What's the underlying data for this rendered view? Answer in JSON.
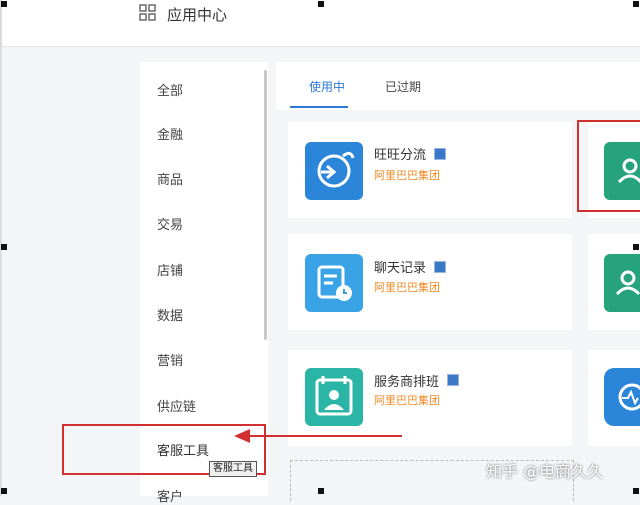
{
  "header": {
    "title": "应用中心",
    "icon": "grid-icon"
  },
  "sidebar": {
    "items": [
      {
        "label": "全部"
      },
      {
        "label": "金融"
      },
      {
        "label": "商品"
      },
      {
        "label": "交易"
      },
      {
        "label": "店铺"
      },
      {
        "label": "数据"
      },
      {
        "label": "营销"
      },
      {
        "label": "供应链"
      },
      {
        "label": "客服工具"
      },
      {
        "label": "客户"
      }
    ],
    "tooltip": "客服工具"
  },
  "tabs": [
    {
      "label": "使用中"
    },
    {
      "label": "已过期"
    }
  ],
  "apps": [
    {
      "name": "旺旺分流",
      "org": "阿里巴巴集团",
      "icon": "wangwang-icon",
      "color": "#2b86d9"
    },
    {
      "name": "聊天记录",
      "org": "阿里巴巴集团",
      "icon": "chat-record-icon",
      "color": "#3aa3e6"
    },
    {
      "name": "服务商排班",
      "org": "阿里巴巴集团",
      "icon": "schedule-icon",
      "color": "#2bb5a6"
    }
  ],
  "colors": {
    "accent": "#2d7ad6",
    "org": "#f08a24",
    "annotation": "#d23030"
  },
  "watermark": "知乎 @电商久久"
}
